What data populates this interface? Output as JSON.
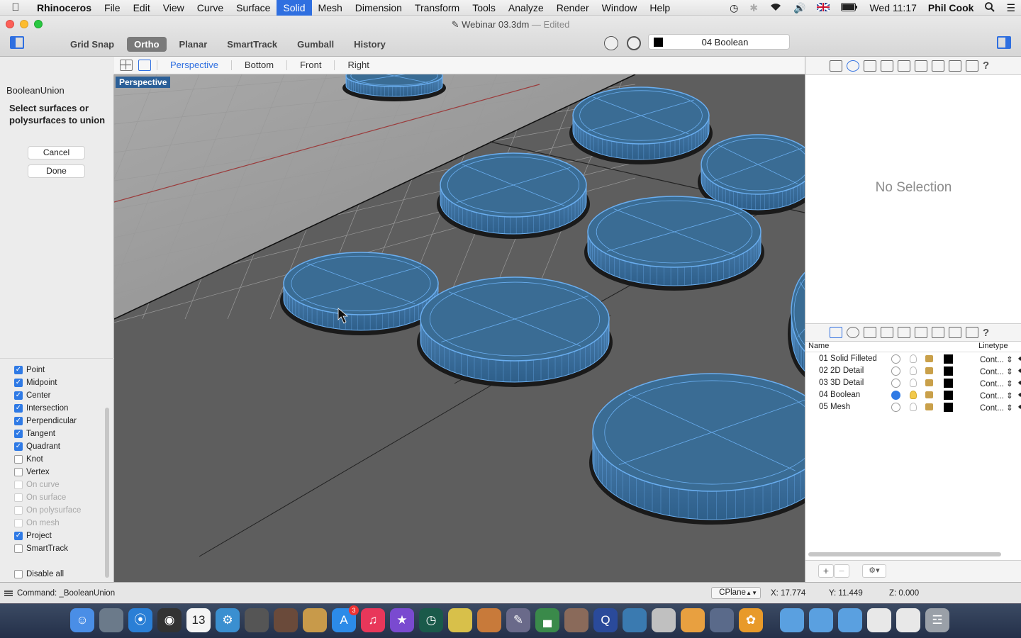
{
  "menubar": {
    "app": "Rhinoceros",
    "items": [
      "File",
      "Edit",
      "View",
      "Curve",
      "Surface",
      "Solid",
      "Mesh",
      "Dimension",
      "Transform",
      "Tools",
      "Analyze",
      "Render",
      "Window",
      "Help"
    ],
    "active": "Solid",
    "clock": "Wed 11:17",
    "user": "Phil Cook"
  },
  "window": {
    "title": "Webinar 03.3dm",
    "edited": "— Edited"
  },
  "toolbar": {
    "modes": [
      "Grid Snap",
      "Ortho",
      "Planar",
      "SmartTrack",
      "Gumball",
      "History"
    ],
    "active_mode": "Ortho",
    "current_layer": "04 Boolean"
  },
  "viewport_tabs": {
    "tabs": [
      "Perspective",
      "Bottom",
      "Front",
      "Right"
    ],
    "selected": "Perspective"
  },
  "viewport": {
    "label": "Perspective",
    "colors": {
      "background": "#5c5c5c",
      "grid": "#8e8e8e",
      "object_fill": "#3a6c94",
      "object_wire": "#6aaef0"
    }
  },
  "command_panel": {
    "command": "BooleanUnion",
    "prompt": "Select surfaces or polysurfaces to union",
    "cancel": "Cancel",
    "done": "Done"
  },
  "osnaps": [
    {
      "label": "Point",
      "checked": true,
      "enabled": true
    },
    {
      "label": "Midpoint",
      "checked": true,
      "enabled": true
    },
    {
      "label": "Center",
      "checked": true,
      "enabled": true
    },
    {
      "label": "Intersection",
      "checked": true,
      "enabled": true
    },
    {
      "label": "Perpendicular",
      "checked": true,
      "enabled": true
    },
    {
      "label": "Tangent",
      "checked": true,
      "enabled": true
    },
    {
      "label": "Quadrant",
      "checked": true,
      "enabled": true
    },
    {
      "label": "Knot",
      "checked": false,
      "enabled": true
    },
    {
      "label": "Vertex",
      "checked": false,
      "enabled": true
    },
    {
      "label": "On curve",
      "checked": false,
      "enabled": false
    },
    {
      "label": "On surface",
      "checked": false,
      "enabled": false
    },
    {
      "label": "On polysurface",
      "checked": false,
      "enabled": false
    },
    {
      "label": "On mesh",
      "checked": false,
      "enabled": false
    },
    {
      "label": "Project",
      "checked": true,
      "enabled": true
    },
    {
      "label": "SmartTrack",
      "checked": false,
      "enabled": true
    }
  ],
  "disable_all": "Disable all",
  "properties": {
    "empty_text": "No Selection"
  },
  "layers": {
    "columns": {
      "name": "Name",
      "linetype": "Linetype"
    },
    "rows": [
      {
        "name": "01 Solid Filleted",
        "current": false,
        "light_on": false,
        "linetype": "Cont..."
      },
      {
        "name": "02 2D Detail",
        "current": false,
        "light_on": false,
        "linetype": "Cont..."
      },
      {
        "name": "03 3D Detail",
        "current": false,
        "light_on": false,
        "linetype": "Cont..."
      },
      {
        "name": "04 Boolean",
        "current": true,
        "light_on": true,
        "linetype": "Cont..."
      },
      {
        "name": "05 Mesh",
        "current": false,
        "light_on": false,
        "linetype": "Cont..."
      }
    ],
    "add": "+",
    "remove": "−"
  },
  "statusbar": {
    "command_line": "Command: _BooleanUnion",
    "cplane": "CPlane",
    "x": "X: 17.774",
    "y": "Y: 11.449",
    "z": "Z: 0.000"
  },
  "dock": {
    "icons": [
      "finder-icon",
      "mail-stamp-icon",
      "safari-icon",
      "camera-icon",
      "calendar-icon",
      "settings-icon",
      "photo-booth-icon",
      "film-icon",
      "notes-icon",
      "app-store-icon",
      "itunes-icon",
      "star-icon",
      "time-machine-icon",
      "pen-tool-icon",
      "keynote-icon",
      "pencil-icon",
      "chart-icon",
      "photos-grid-icon",
      "quicktime-icon",
      "presentation-icon",
      "dancer-icon",
      "photos-icon",
      "image-capture-icon",
      "flower-icon",
      "folder-apps-icon",
      "folder-docs-icon",
      "folder-dropbox-icon",
      "browser-window-icon",
      "window-icon",
      "trash-icon"
    ],
    "calendar_day": "13",
    "badge": "3"
  }
}
